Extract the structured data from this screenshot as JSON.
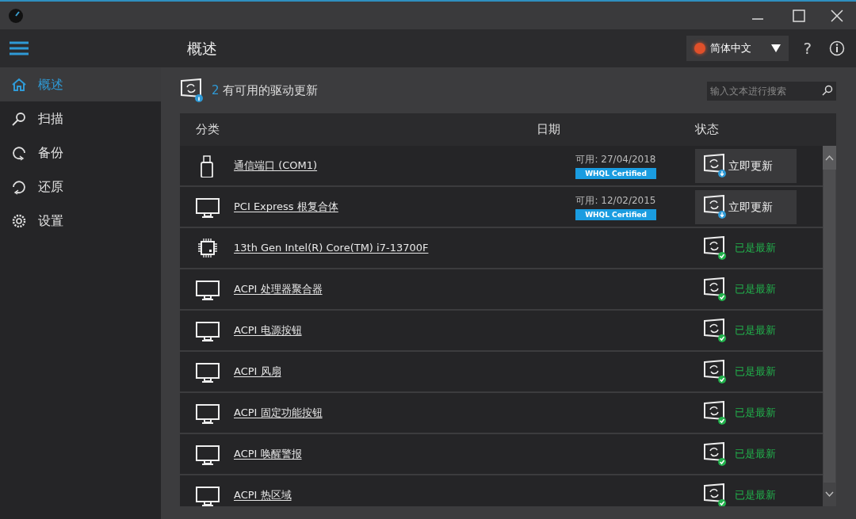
{
  "header": {
    "title": "概述",
    "language": "简体中文",
    "help": "?"
  },
  "sidebar": {
    "items": [
      {
        "label": "概述",
        "selected": true
      },
      {
        "label": "扫描",
        "selected": false
      },
      {
        "label": "备份",
        "selected": false
      },
      {
        "label": "还原",
        "selected": false
      },
      {
        "label": "设置",
        "selected": false
      }
    ]
  },
  "summary": {
    "count": "2",
    "text": "有可用的驱动更新"
  },
  "search": {
    "placeholder": "输入文本进行搜索"
  },
  "table": {
    "columns": [
      "分类",
      "日期",
      "状态"
    ],
    "rows": [
      {
        "name": "通信端口 (COM1)",
        "kind": "update",
        "date": "可用: 27/04/2018",
        "badge": "WHQL Certified",
        "status": "立即更新"
      },
      {
        "name": "PCI Express 根复合体",
        "kind": "update",
        "date": "可用: 12/02/2015",
        "badge": "WHQL Certified",
        "status": "立即更新"
      },
      {
        "name": "13th Gen Intel(R) Core(TM) i7-13700F",
        "kind": "current",
        "status": "已是最新"
      },
      {
        "name": "ACPI 处理器聚合器",
        "kind": "current",
        "status": "已是最新"
      },
      {
        "name": "ACPI 电源按钮",
        "kind": "current",
        "status": "已是最新"
      },
      {
        "name": "ACPI 风扇",
        "kind": "current",
        "status": "已是最新"
      },
      {
        "name": "ACPI 固定功能按钮",
        "kind": "current",
        "status": "已是最新"
      },
      {
        "name": "ACPI 唤醒警报",
        "kind": "current",
        "status": "已是最新"
      },
      {
        "name": "ACPI 热区域",
        "kind": "current",
        "status": "已是最新"
      }
    ]
  }
}
